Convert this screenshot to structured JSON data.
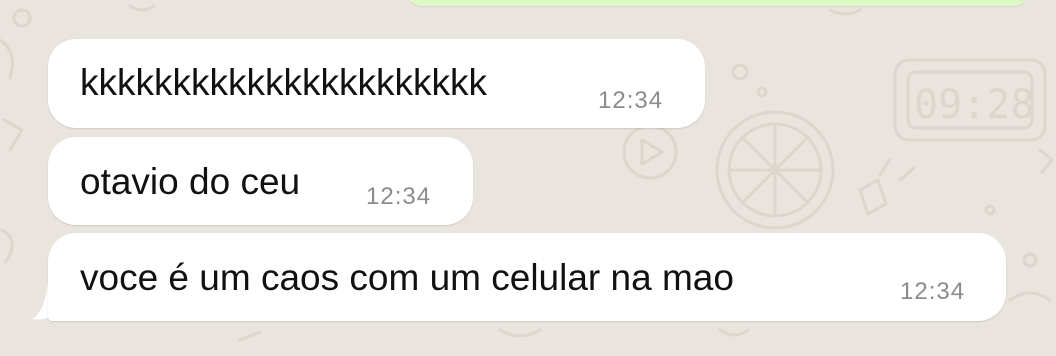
{
  "chat": {
    "messages": [
      {
        "text": "kkkkkkkkkkkkkkkkkkkkkk",
        "time": "12:34"
      },
      {
        "text": "otavio do ceu",
        "time": "12:34"
      },
      {
        "text": "voce é um caos com um celular na mao",
        "time": "12:34"
      }
    ],
    "wallpaper_doodle_text": "09:28"
  },
  "colors": {
    "background": "#e9e4dd",
    "incoming_bubble": "#ffffff",
    "outgoing_bubble": "#dcf8c6",
    "timestamp": "#8b8b8b",
    "message_text": "#111111"
  }
}
